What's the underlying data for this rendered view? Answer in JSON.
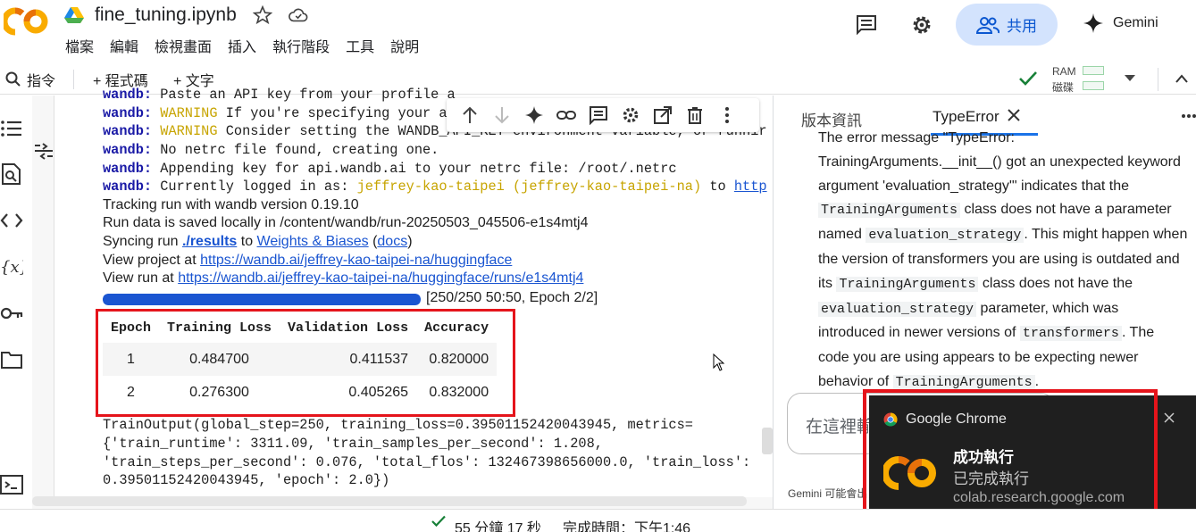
{
  "app": {
    "filename": "fine_tuning.ipynb",
    "brand_color": "#f9ab00",
    "accent_color": "#1a73e8",
    "menu": [
      "檔案",
      "編輯",
      "檢視畫面",
      "插入",
      "執行階段",
      "工具",
      "說明"
    ],
    "share_label": "共用",
    "gemini_label": "Gemini"
  },
  "toolbar": {
    "command_label": "指令",
    "add_code_label": "+ 程式碼",
    "add_text_label": "+ 文字",
    "ram_label": "RAM",
    "disk_label": "磁碟"
  },
  "cell": {
    "lines": [
      {
        "prefix": "wandb:",
        "level": "",
        "text": " Paste an API key from your profile a"
      },
      {
        "prefix": "wandb:",
        "level": "WARNING",
        "text": " If you're specifying your ap"
      },
      {
        "prefix": "wandb:",
        "level": "WARNING",
        "text": " Consider setting the WANDB_API_KEY environment variable, or runnir"
      },
      {
        "prefix": "wandb:",
        "level": "",
        "text": " No netrc file found, creating one."
      },
      {
        "prefix": "wandb:",
        "level": "",
        "text": " Appending key for api.wandb.ai to your netrc file: /root/.netrc"
      }
    ],
    "logged_in_prefix": "wandb:",
    "logged_in_text": " Currently logged in as: ",
    "user": "jeffrey-kao-taipei",
    "user_team": "(jeffrey-kao-taipei-na)",
    "to_text": " to ",
    "http_link": "http",
    "tracking_text": "Tracking run with wandb version 0.19.10",
    "run_data_text": "Run data is saved locally in /content/wandb/run-20250503_045506-e1s4mtj4",
    "syncing_prefix": "Syncing run ",
    "syncing_run": "./results",
    "syncing_to": " to ",
    "syncing_wb": "Weights & Biases",
    "syncing_paren_open": " (",
    "syncing_docs": "docs",
    "syncing_paren_close": ")",
    "view_project_prefix": "View project at ",
    "view_project_url": "https://wandb.ai/jeffrey-kao-taipei-na/huggingface",
    "view_run_prefix": "View run at ",
    "view_run_url": "https://wandb.ai/jeffrey-kao-taipei-na/huggingface/runs/e1s4mtj4",
    "progress_fraction": 1.0,
    "progress_text": "[250/250 50:50, Epoch 2/2]",
    "table": {
      "headers": [
        "Epoch",
        "Training Loss",
        "Validation Loss",
        "Accuracy"
      ],
      "rows": [
        [
          "1",
          "0.484700",
          "0.411537",
          "0.820000"
        ],
        [
          "2",
          "0.276300",
          "0.405265",
          "0.832000"
        ]
      ]
    },
    "train_output": [
      "TrainOutput(global_step=250, training_loss=0.39501152420043945, metrics=",
      "{'train_runtime': 3311.09, 'train_samples_per_second': 1.208,",
      "'train_steps_per_second': 0.076, 'total_flos': 132467398656000.0, 'train_loss':",
      "0.39501152420043945, 'epoch': 2.0})"
    ]
  },
  "panel": {
    "tab_version": "版本資訊",
    "tab_error": "TypeError",
    "answer_first": "The error message \"TypeError: TrainingArguments.__init__()",
    "answer_line2": "got an unexpected keyword argument",
    "answer_line3": "'evaluation_strategy'\" indicates that the",
    "code_ta": "TrainingArguments",
    "ans_a": " class does not have a parameter",
    "ans_b": "named ",
    "code_es": "evaluation_strategy",
    "ans_c": ". This might happen when the version of transformers you are using is outdated and its ",
    "ans_d": " class does not have the ",
    "ans_e": " parameter, which was introduced in newer versions of ",
    "code_tf": "transformers",
    "ans_f": ". The code you are using appears to be expecting newer behavior of ",
    "ans_g": ".",
    "input_placeholder": "在這裡輸",
    "disclaimer": "Gemini 可能會出"
  },
  "notification": {
    "app_name": "Google Chrome",
    "title": "成功執行",
    "body": "已完成執行",
    "site": "colab.research.google.com"
  },
  "status": {
    "elapsed": "55 分鐘 17 秒",
    "completed": "完成時間：下午1:46"
  }
}
